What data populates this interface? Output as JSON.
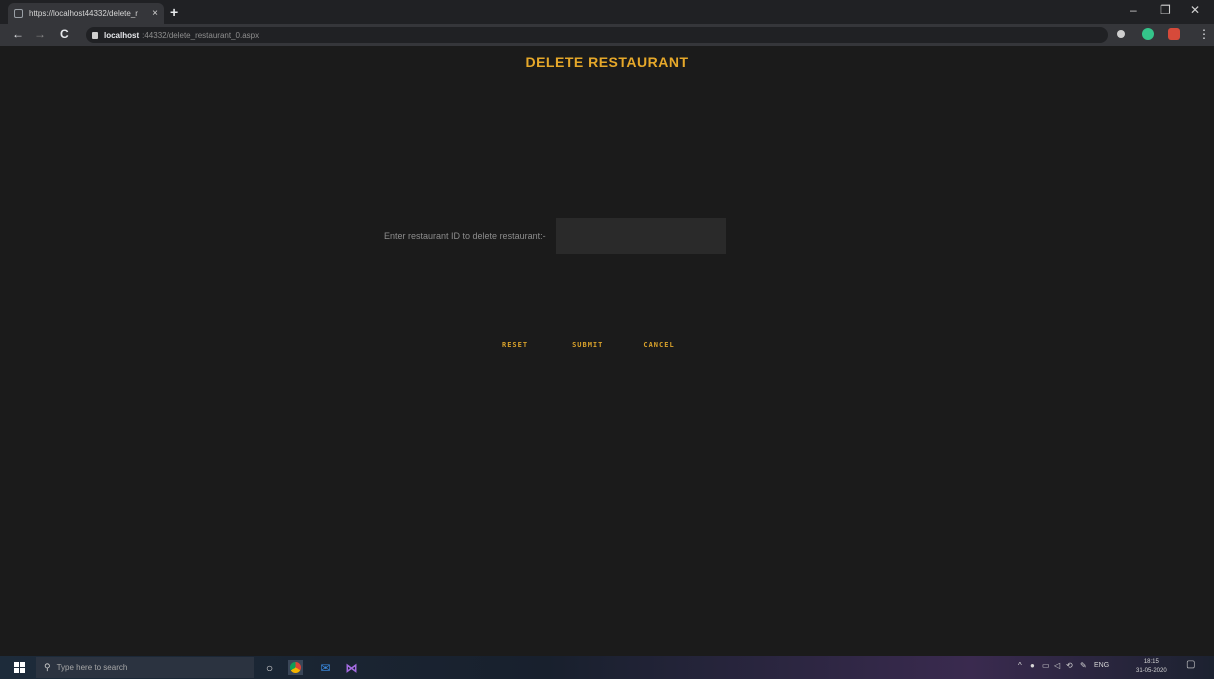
{
  "browser": {
    "tab_title": "https://localhost44332/delete_r",
    "tab_close": "×",
    "new_tab": "+",
    "minimize": "–",
    "maximize": "❐",
    "close": "✕",
    "url_host": "localhost",
    "url_path": ":44332/delete_restaurant_0.aspx",
    "back": "←",
    "forward": "→",
    "reload": "C",
    "menu": "⋮"
  },
  "page": {
    "title": "DELETE RESTAURANT",
    "label": "Enter restaurant ID to delete restaurant:-",
    "input_value": "",
    "buttons": {
      "reset": "RESET",
      "submit": "SUBMIT",
      "cancel": "CANCEL"
    }
  },
  "taskbar": {
    "search_placeholder": "Type here to search",
    "lang": "ENG",
    "time": "18:15",
    "date": "31-05-2020"
  },
  "colors": {
    "accent": "#e6a82a",
    "page_bg": "#1b1b1b"
  }
}
